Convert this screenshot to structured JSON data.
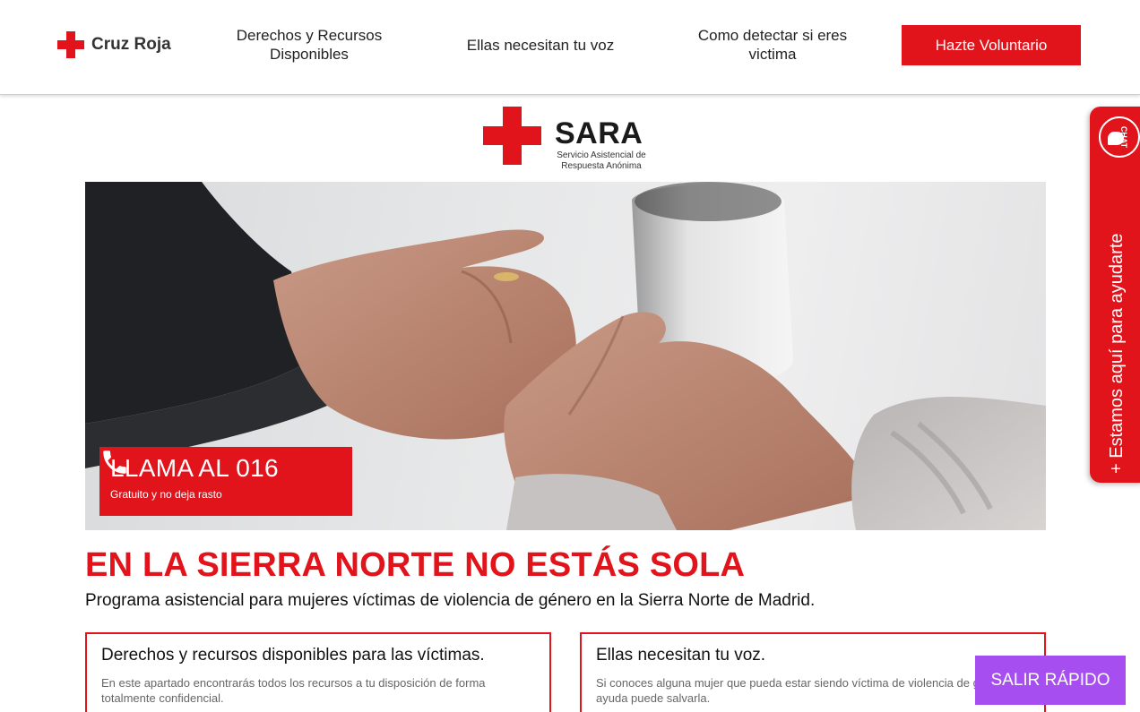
{
  "header": {
    "brand": "Cruz Roja",
    "nav": [
      "Derechos y Recursos Disponibles",
      "Ellas necesitan tu voz",
      "Como detectar si eres victima"
    ],
    "cta": "Hazte Voluntario"
  },
  "logo": {
    "name": "SARA",
    "subtitle": "Servicio Asistencial de Respuesta Anónima"
  },
  "hero": {
    "call_title": "LLAMA AL 016",
    "call_subtitle": "Gratuito y no deja rasto",
    "phone_icon": "phone-icon"
  },
  "main": {
    "headline": "EN LA SIERRA NORTE NO ESTÁS SOLA",
    "subheadline": "Programa asistencial para mujeres víctimas de violencia de género en la Sierra Norte de Madrid."
  },
  "cards": [
    {
      "title": "Derechos y recursos disponibles para las víctimas.",
      "text": "En este apartado encontrarás todos los recursos a tu disposición de forma totalmente confidencial."
    },
    {
      "title": "Ellas necesitan tu voz.",
      "text": "Si conoces alguna mujer que pueda estar siendo víctima de violencia de género tu ayuda puede salvarla."
    }
  ],
  "side_tab": {
    "chat_label": "CHAT",
    "text": "+ Estamos aquí para ayudarte"
  },
  "exit_button": "SALIR RÁPIDO",
  "colors": {
    "brand_red": "#e1141c",
    "exit_purple": "#a74ef0"
  }
}
